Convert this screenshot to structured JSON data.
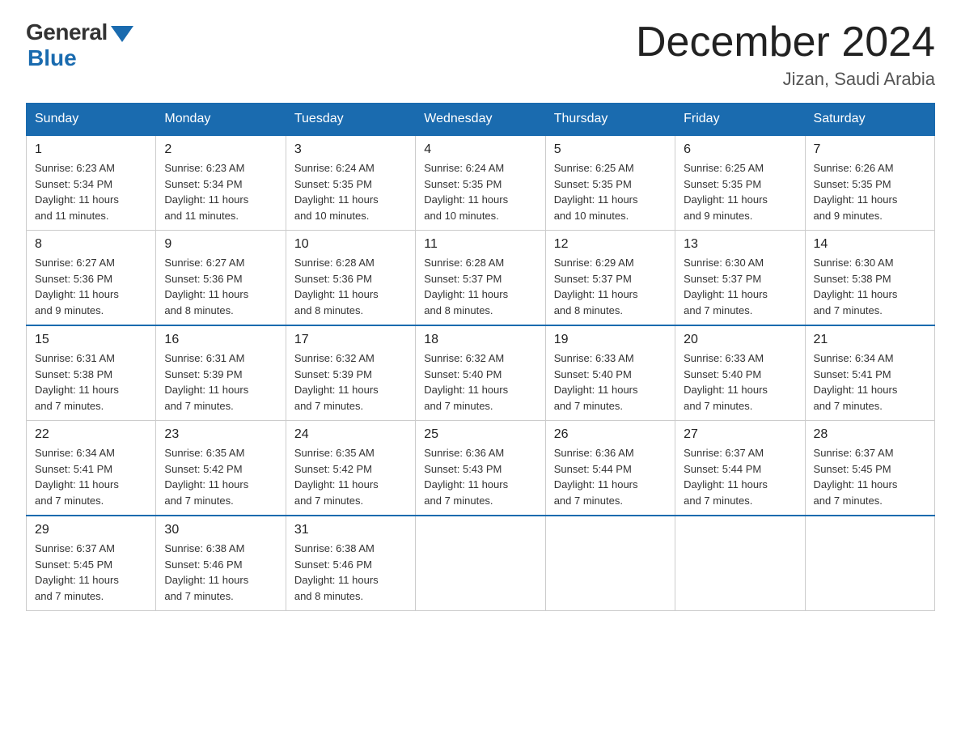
{
  "logo": {
    "general": "General",
    "blue": "Blue"
  },
  "title": "December 2024",
  "subtitle": "Jizan, Saudi Arabia",
  "days_of_week": [
    "Sunday",
    "Monday",
    "Tuesday",
    "Wednesday",
    "Thursday",
    "Friday",
    "Saturday"
  ],
  "weeks": [
    [
      {
        "day": "1",
        "sunrise": "6:23 AM",
        "sunset": "5:34 PM",
        "daylight": "11 hours and 11 minutes."
      },
      {
        "day": "2",
        "sunrise": "6:23 AM",
        "sunset": "5:34 PM",
        "daylight": "11 hours and 11 minutes."
      },
      {
        "day": "3",
        "sunrise": "6:24 AM",
        "sunset": "5:35 PM",
        "daylight": "11 hours and 10 minutes."
      },
      {
        "day": "4",
        "sunrise": "6:24 AM",
        "sunset": "5:35 PM",
        "daylight": "11 hours and 10 minutes."
      },
      {
        "day": "5",
        "sunrise": "6:25 AM",
        "sunset": "5:35 PM",
        "daylight": "11 hours and 10 minutes."
      },
      {
        "day": "6",
        "sunrise": "6:25 AM",
        "sunset": "5:35 PM",
        "daylight": "11 hours and 9 minutes."
      },
      {
        "day": "7",
        "sunrise": "6:26 AM",
        "sunset": "5:35 PM",
        "daylight": "11 hours and 9 minutes."
      }
    ],
    [
      {
        "day": "8",
        "sunrise": "6:27 AM",
        "sunset": "5:36 PM",
        "daylight": "11 hours and 9 minutes."
      },
      {
        "day": "9",
        "sunrise": "6:27 AM",
        "sunset": "5:36 PM",
        "daylight": "11 hours and 8 minutes."
      },
      {
        "day": "10",
        "sunrise": "6:28 AM",
        "sunset": "5:36 PM",
        "daylight": "11 hours and 8 minutes."
      },
      {
        "day": "11",
        "sunrise": "6:28 AM",
        "sunset": "5:37 PM",
        "daylight": "11 hours and 8 minutes."
      },
      {
        "day": "12",
        "sunrise": "6:29 AM",
        "sunset": "5:37 PM",
        "daylight": "11 hours and 8 minutes."
      },
      {
        "day": "13",
        "sunrise": "6:30 AM",
        "sunset": "5:37 PM",
        "daylight": "11 hours and 7 minutes."
      },
      {
        "day": "14",
        "sunrise": "6:30 AM",
        "sunset": "5:38 PM",
        "daylight": "11 hours and 7 minutes."
      }
    ],
    [
      {
        "day": "15",
        "sunrise": "6:31 AM",
        "sunset": "5:38 PM",
        "daylight": "11 hours and 7 minutes."
      },
      {
        "day": "16",
        "sunrise": "6:31 AM",
        "sunset": "5:39 PM",
        "daylight": "11 hours and 7 minutes."
      },
      {
        "day": "17",
        "sunrise": "6:32 AM",
        "sunset": "5:39 PM",
        "daylight": "11 hours and 7 minutes."
      },
      {
        "day": "18",
        "sunrise": "6:32 AM",
        "sunset": "5:40 PM",
        "daylight": "11 hours and 7 minutes."
      },
      {
        "day": "19",
        "sunrise": "6:33 AM",
        "sunset": "5:40 PM",
        "daylight": "11 hours and 7 minutes."
      },
      {
        "day": "20",
        "sunrise": "6:33 AM",
        "sunset": "5:40 PM",
        "daylight": "11 hours and 7 minutes."
      },
      {
        "day": "21",
        "sunrise": "6:34 AM",
        "sunset": "5:41 PM",
        "daylight": "11 hours and 7 minutes."
      }
    ],
    [
      {
        "day": "22",
        "sunrise": "6:34 AM",
        "sunset": "5:41 PM",
        "daylight": "11 hours and 7 minutes."
      },
      {
        "day": "23",
        "sunrise": "6:35 AM",
        "sunset": "5:42 PM",
        "daylight": "11 hours and 7 minutes."
      },
      {
        "day": "24",
        "sunrise": "6:35 AM",
        "sunset": "5:42 PM",
        "daylight": "11 hours and 7 minutes."
      },
      {
        "day": "25",
        "sunrise": "6:36 AM",
        "sunset": "5:43 PM",
        "daylight": "11 hours and 7 minutes."
      },
      {
        "day": "26",
        "sunrise": "6:36 AM",
        "sunset": "5:44 PM",
        "daylight": "11 hours and 7 minutes."
      },
      {
        "day": "27",
        "sunrise": "6:37 AM",
        "sunset": "5:44 PM",
        "daylight": "11 hours and 7 minutes."
      },
      {
        "day": "28",
        "sunrise": "6:37 AM",
        "sunset": "5:45 PM",
        "daylight": "11 hours and 7 minutes."
      }
    ],
    [
      {
        "day": "29",
        "sunrise": "6:37 AM",
        "sunset": "5:45 PM",
        "daylight": "11 hours and 7 minutes."
      },
      {
        "day": "30",
        "sunrise": "6:38 AM",
        "sunset": "5:46 PM",
        "daylight": "11 hours and 7 minutes."
      },
      {
        "day": "31",
        "sunrise": "6:38 AM",
        "sunset": "5:46 PM",
        "daylight": "11 hours and 8 minutes."
      },
      null,
      null,
      null,
      null
    ]
  ],
  "labels": {
    "sunrise": "Sunrise:",
    "sunset": "Sunset:",
    "daylight": "Daylight:"
  }
}
